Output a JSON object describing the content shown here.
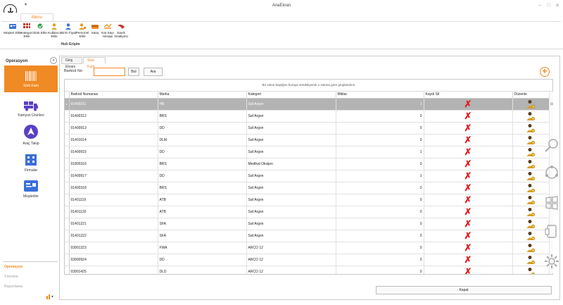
{
  "window": {
    "title": "AnaEkran",
    "qat": "▾",
    "min": "–",
    "max": "□",
    "close": "✕"
  },
  "ribbon": {
    "tab": "Menu",
    "group_label": "Hızlı Erişim",
    "buttons": [
      {
        "label": "Müşteri Ekle",
        "icon": "customer-add-icon"
      },
      {
        "label": "Kategori Ekle",
        "icon": "category-add-icon"
      },
      {
        "label": "Stok Ekle",
        "icon": "stock-add-icon"
      },
      {
        "label": "Kullanıcı Ekle",
        "icon": "user-add-icon"
      },
      {
        "label": "Birim Fiyat",
        "icon": "unit-price-icon"
      },
      {
        "label": "Personel Ekle",
        "icon": "staff-add-icon"
      },
      {
        "label": "Satış",
        "icon": "sales-icon"
      },
      {
        "label": "Kat Sayı Hesapı",
        "icon": "coefficient-icon"
      },
      {
        "label": "Savık İnsaliyesi",
        "icon": "delivery-icon"
      }
    ]
  },
  "sidebar": {
    "title": "Operasyon",
    "collapse": "«",
    "items": [
      {
        "label": "Stok Kartı",
        "icon": "barcode-icon"
      },
      {
        "label": "Kamyon Ürünleri",
        "icon": "truck-icon"
      },
      {
        "label": "Araç Takip",
        "icon": "navigation-icon"
      },
      {
        "label": "Firmalar",
        "icon": "building-icon"
      },
      {
        "label": "Müşteriler",
        "icon": "contact-card-icon"
      }
    ],
    "bottom": [
      "Operasyon",
      "Yönetim",
      "Raporlama"
    ]
  },
  "tabs": [
    "Giriş Ekranı",
    "Stok Kartı"
  ],
  "search": {
    "label": "Barkod No",
    "value": "",
    "find": "Bul",
    "search": "Ara"
  },
  "grid": {
    "group_hint": "Bir sütun başlığını buraya sürükleyerek o sütuna göre gruplandırın",
    "columns": [
      "Barkod Numarası",
      "Marka",
      "Kategori",
      "Miktar",
      "Kaydı Sil",
      "Düzenle"
    ],
    "rows": [
      [
        "01400211",
        "HB",
        "Saf Argon",
        "1"
      ],
      [
        "01400312",
        "BRS",
        "Saf Argon",
        "0"
      ],
      [
        "01400913",
        "DD",
        "Saf Argon",
        "0"
      ],
      [
        "01401014",
        "DLM",
        "Saf Argon",
        "0"
      ],
      [
        "01400915",
        "DD",
        "Saf Argon",
        "1"
      ],
      [
        "01800316",
        "BRS",
        "Medikal Oksijen",
        "0"
      ],
      [
        "01400917",
        "DD",
        "Saf Argon",
        "1"
      ],
      [
        "01400318",
        "BRS",
        "Saf Argon",
        "0"
      ],
      [
        "01401119",
        "ATB",
        "Saf Argon",
        "0"
      ],
      [
        "01401120",
        "ATB",
        "Saf Argon",
        "0"
      ],
      [
        "01401221",
        "SFA",
        "Saf Argon",
        "0"
      ],
      [
        "01401222",
        "SFA",
        "Saf Argon",
        "0"
      ],
      [
        "03901323",
        "FWA",
        "ARCO 12",
        "0"
      ],
      [
        "03900924",
        "DD",
        "ARCO 12",
        "0"
      ],
      [
        "03901425",
        "DLD",
        "ARCO 12",
        "0"
      ]
    ]
  },
  "close_label": "Kapat",
  "colors": {
    "accent": "#f08a24",
    "delete": "#e01a1a",
    "selected_row": "#b3b3b3"
  }
}
